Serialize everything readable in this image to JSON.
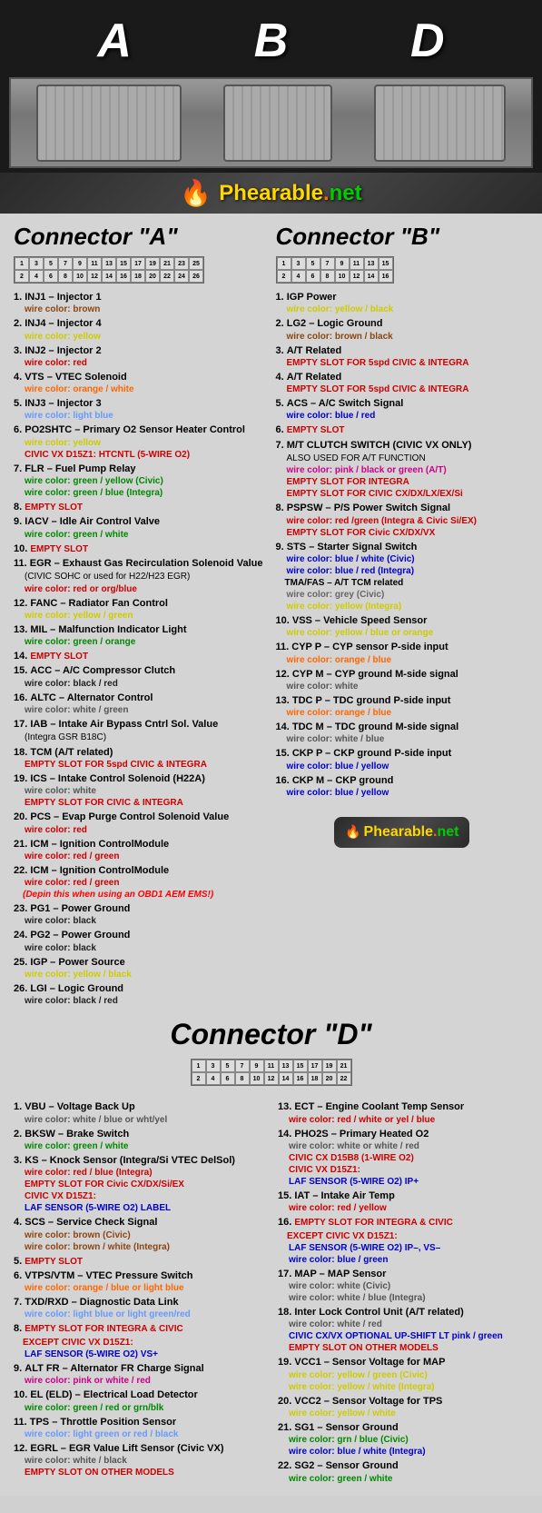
{
  "header": {
    "labels": [
      "A",
      "B",
      "D"
    ],
    "logo": "Phearable.net"
  },
  "connectorA": {
    "title": "Connector \"A\"",
    "pins_row1": [
      1,
      3,
      5,
      7,
      9,
      11,
      13,
      15,
      17,
      19,
      21,
      23,
      25
    ],
    "pins_row2": [
      2,
      4,
      6,
      8,
      10,
      12,
      14,
      16,
      18,
      20,
      22,
      24,
      26
    ],
    "items": [
      {
        "num": "1.",
        "label": "INJ1 – Injector 1",
        "color": "wire color: brown",
        "colorClass": "color-brown"
      },
      {
        "num": "2.",
        "label": "INJ4 – Injector 4",
        "color": "wire color: yellow",
        "colorClass": "color-yellow"
      },
      {
        "num": "3.",
        "label": "INJ2 – Injector 2",
        "color": "wire color: red",
        "colorClass": "color-red"
      },
      {
        "num": "4.",
        "label": "VTS – VTEC Solenoid",
        "color": "wire color: orange / white",
        "colorClass": "color-orange"
      },
      {
        "num": "5.",
        "label": "INJ3 – Injector 3",
        "color": "wire color: light blue",
        "colorClass": "color-lightblue"
      },
      {
        "num": "6.",
        "label": "PO2SHTC – Primary O2 Sensor Heater Control",
        "color": "wire color: yellow",
        "colorClass": "color-yellow",
        "note": "CIVIC VX D15Z1: HTCNTL (5-WIRE O2)",
        "noteClass": "civic-note"
      },
      {
        "num": "7.",
        "label": "FLR – Fuel Pump Relay",
        "color": "wire color: green / yellow (Civic)",
        "colorClass": "color-green",
        "color2": "wire color: green / blue (Integra)",
        "color2Class": "color-green"
      },
      {
        "num": "8.",
        "label": "EMPTY SLOT",
        "empty": true
      },
      {
        "num": "9.",
        "label": "IACV – Idle Air Control Valve",
        "color": "wire color: green / white",
        "colorClass": "color-green"
      },
      {
        "num": "10.",
        "label": "EMPTY SLOT",
        "empty": true
      },
      {
        "num": "11.",
        "label": "EGR – Exhaust Gas Recirculation Solenoid Value",
        "sublabel": "(CIVIC SOHC or used for H22/H23 EGR)",
        "color": "wire color: red or org/blue",
        "colorClass": "color-red"
      },
      {
        "num": "12.",
        "label": "FANC – Radiator Fan Control",
        "color": "wire color: yellow / green",
        "colorClass": "color-yellow"
      },
      {
        "num": "13.",
        "label": "MIL – Malfunction Indicator Light",
        "color": "wire color: green / orange",
        "colorClass": "color-green"
      },
      {
        "num": "14.",
        "label": "EMPTY SLOT",
        "empty": true
      },
      {
        "num": "15.",
        "label": "ACC – A/C Compressor Clutch",
        "color": "wire color: black / red",
        "colorClass": "color-black"
      },
      {
        "num": "16.",
        "label": "ALTC – Alternator Control",
        "color": "wire color: white / green",
        "colorClass": "color-white"
      },
      {
        "num": "17.",
        "label": "IAB – Intake Air Bypass Cntrl Sol. Value",
        "sublabel": "(Integra GSR B18C)",
        "color": "",
        "colorClass": ""
      },
      {
        "num": "18.",
        "label": "TCM (A/T related)",
        "empty": true,
        "emptyLabel": "EMPTY SLOT FOR 5spd CIVIC & INTEGRA"
      },
      {
        "num": "19.",
        "label": "ICS – Intake Control Solenoid (H22A)",
        "color": "wire color: white",
        "colorClass": "color-white",
        "note": "EMPTY SLOT FOR CIVIC & INTEGRA",
        "noteClass": "civic-note"
      },
      {
        "num": "20.",
        "label": "PCS – Evap Purge Control Solenoid Value",
        "color": "wire color: red",
        "colorClass": "color-red"
      },
      {
        "num": "21.",
        "label": "ICM – Ignition ControlModule",
        "color": "wire color: red / green",
        "colorClass": "color-red"
      },
      {
        "num": "22.",
        "label": "ICM – Ignition ControlModule",
        "color": "wire color: red / green",
        "colorClass": "color-red",
        "note": "(Depin this when using an OBD1 AEM EMS!)",
        "noteClass": "note-depin"
      },
      {
        "num": "23.",
        "label": "PG1 – Power Ground",
        "color": "wire color: black",
        "colorClass": "color-black"
      },
      {
        "num": "24.",
        "label": "PG2 – Power Ground",
        "color": "wire color: black",
        "colorClass": "color-black"
      },
      {
        "num": "25.",
        "label": "IGP  – Power Source",
        "color": "wire color: yellow / black",
        "colorClass": "color-yellow"
      },
      {
        "num": "26.",
        "label": "LGI – Logic Ground",
        "color": "wire color: black / red",
        "colorClass": "color-black"
      }
    ]
  },
  "connectorB": {
    "title": "Connector \"B\"",
    "pins_row1": [
      1,
      3,
      5,
      7,
      9,
      11,
      13,
      15
    ],
    "pins_row2": [
      2,
      4,
      6,
      8,
      10,
      12,
      14,
      16
    ],
    "items": [
      {
        "num": "1.",
        "label": "IGP  Power",
        "color": "wire color: yellow / black",
        "colorClass": "color-yellow"
      },
      {
        "num": "2.",
        "label": "LG2 – Logic Ground",
        "color": "wire color: brown / black",
        "colorClass": "color-brown"
      },
      {
        "num": "3.",
        "label": "A/T Related",
        "emptyLabel": "EMPTY SLOT FOR 5spd CIVIC & INTEGRA"
      },
      {
        "num": "4.",
        "label": "A/T Related",
        "emptyLabel": "EMPTY SLOT FOR 5spd CIVIC & INTEGRA"
      },
      {
        "num": "5.",
        "label": "ACS – A/C Switch Signal",
        "color": "wire color: blue / red",
        "colorClass": "color-blue"
      },
      {
        "num": "6.",
        "label": "EMPTY SLOT",
        "empty": true
      },
      {
        "num": "7.",
        "label": "M/T CLUTCH SWITCH (CIVIC VX ONLY)",
        "sublabel": "ALSO USED FOR A/T FUNCTION",
        "color": "wire color: pink / black or green (A/T)",
        "colorClass": "color-pink",
        "note": "EMPTY SLOT FOR INTEGRA",
        "noteClass": "civic-note",
        "note2": "EMPTY SLOT FOR CIVIC CX/DX/LX/EX/Si",
        "note2Class": "civic-note"
      },
      {
        "num": "8.",
        "label": "PSPSW – P/S Power Switch Signal",
        "color": "wire color: red /green (Integra & Civic Si/EX)",
        "colorClass": "color-red",
        "note": "EMPTY SLOT FOR Civic CX/DX/VX",
        "noteClass": "civic-note"
      },
      {
        "num": "9.",
        "label": "STS – Starter Signal Switch",
        "color": "wire color: blue / white (Civic)",
        "colorClass": "color-blue",
        "color2": "wire color: blue / red (Integra)",
        "color2Class": "color-blue",
        "sublabel2": "TMA/FAS – A/T TCM related",
        "color3": "wire color: grey (Civic)",
        "color3Class": "color-grey",
        "color4": "wire color: yellow (Integra)",
        "color4Class": "color-yellow"
      },
      {
        "num": "10.",
        "label": "VSS – Vehicle Speed Sensor",
        "color": "wire color: yellow / blue or orange",
        "colorClass": "color-yellow"
      },
      {
        "num": "11.",
        "label": "CYP P – CYP sensor P-side input",
        "color": "wire color: orange / blue",
        "colorClass": "color-orange"
      },
      {
        "num": "12.",
        "label": "CYP M – CYP ground M-side signal",
        "color": "wire color: white",
        "colorClass": "color-white"
      },
      {
        "num": "13.",
        "label": "TDC P – TDC ground P-side input",
        "color": "wire color: orange / blue",
        "colorClass": "color-orange"
      },
      {
        "num": "14.",
        "label": "TDC M – TDC ground M-side signal",
        "color": "wire color: white / blue",
        "colorClass": "color-white"
      },
      {
        "num": "15.",
        "label": "CKP P – CKP ground P-side input",
        "color": "wire color: blue / yellow",
        "colorClass": "color-blue"
      },
      {
        "num": "16.",
        "label": "CKP M – CKP ground",
        "color": "wire color: blue / yellow",
        "colorClass": "color-blue"
      }
    ]
  },
  "connectorD": {
    "title": "Connector \"D\"",
    "pins_row1": [
      1,
      3,
      5,
      7,
      9,
      11,
      13,
      15,
      17,
      19,
      21
    ],
    "pins_row2": [
      2,
      4,
      6,
      8,
      10,
      12,
      14,
      16,
      18,
      20,
      22
    ],
    "items_left": [
      {
        "num": "1.",
        "label": "VBU – Voltage Back Up",
        "color": "wire color: white / blue or wht/yel",
        "colorClass": "color-white"
      },
      {
        "num": "2.",
        "label": "BKSW – Brake Switch",
        "color": "wire color: green / white",
        "colorClass": "color-green"
      },
      {
        "num": "3.",
        "label": "KS – Knock Sensor (Integra/Si VTEC DelSol)",
        "color": "wire color: red / blue (Integra)",
        "colorClass": "color-red",
        "note": "EMPTY SLOT FOR Civic CX/DX/Si/EX",
        "noteClass": "civic-note",
        "note2": "CIVIC VX D15Z1:",
        "note2Class": "civic-note",
        "note3": "LAF SENSOR (5-WIRE O2) LABEL",
        "note3Class": "note-blue"
      },
      {
        "num": "4.",
        "label": "SCS – Service Check Signal",
        "color": "wire color: brown (Civic)",
        "colorClass": "color-brown",
        "color2": "wire color: brown / white (Integra)",
        "color2Class": "color-brown"
      },
      {
        "num": "5.",
        "label": "EMPTY SLOT",
        "empty": true
      },
      {
        "num": "6.",
        "label": "VTPS/VTM – VTEC Pressure Switch",
        "color": "wire color: orange / blue or light blue",
        "colorClass": "color-orange"
      },
      {
        "num": "7.",
        "label": "TXD/RXD – Diagnostic Data Link",
        "color": "wire color: light blue or light green/red",
        "colorClass": "color-lightblue"
      },
      {
        "num": "8.",
        "label": "EMPTY SLOT FOR INTEGRA & CIVIC",
        "emptyClass": "civic-note",
        "sublabel": "EXCEPT CIVIC VX D15Z1:",
        "sublabelClass": "civic-note",
        "note": "LAF SENSOR (5-WIRE O2) VS+",
        "noteClass": "note-blue"
      },
      {
        "num": "9.",
        "label": "ALT FR – Alternator FR Charge Signal",
        "color": "wire color: pink or white / red",
        "colorClass": "color-pink"
      },
      {
        "num": "10.",
        "label": "EL (ELD) – Electrical Load Detector",
        "color": "wire color: green / red or grn/blk",
        "colorClass": "color-green"
      },
      {
        "num": "11.",
        "label": "TPS – Throttle Position Sensor",
        "color": "wire color: light green or red / black",
        "colorClass": "color-lightblue"
      },
      {
        "num": "12.",
        "label": "EGRL – EGR Value Lift Sensor (Civic VX)",
        "color": "wire color: white / black",
        "colorClass": "color-white",
        "note": "EMPTY SLOT ON OTHER MODELS",
        "noteClass": "civic-note"
      }
    ],
    "items_right": [
      {
        "num": "13.",
        "label": "ECT – Engine Coolant Temp Sensor",
        "color": "wire color: red / white or yel / blue",
        "colorClass": "color-red"
      },
      {
        "num": "14.",
        "label": "PHO2S – Primary Heated O2",
        "color": "wire color: white or white / red",
        "colorClass": "color-white",
        "note": "CIVIC CX D15B8 (1-WIRE O2)",
        "noteClass": "civic-note",
        "note2": "CIVIC VX D15Z1:",
        "note2Class": "civic-note",
        "note3": "LAF SENSOR (5-WIRE O2) IP+",
        "note3Class": "note-blue"
      },
      {
        "num": "15.",
        "label": "IAT – Intake Air Temp",
        "color": "wire color: red / yellow",
        "colorClass": "color-red"
      },
      {
        "num": "16.",
        "label": "EMPTY SLOT FOR INTEGRA & CIVIC",
        "emptyClass": "civic-note",
        "sublabel": "EXCEPT CIVIC VX D15Z1:",
        "sublabelClass": "civic-note",
        "note": "LAF SENSOR (5-WIRE O2) IP–, VS–",
        "noteClass": "note-blue",
        "color": "wire color: blue / green",
        "colorClass": "color-blue"
      },
      {
        "num": "17.",
        "label": "MAP – MAP Sensor",
        "color": "wire color: white (Civic)",
        "colorClass": "color-white",
        "color2": "wire color: white / blue (Integra)",
        "color2Class": "color-white"
      },
      {
        "num": "18.",
        "label": "Inter Lock Control Unit (A/T related)",
        "color": "wire color: white / red",
        "colorClass": "color-white",
        "note": "CIVIC CX/VX OPTIONAL UP-SHIFT LT  pink / green",
        "noteClass": "note-blue",
        "note2": "EMPTY SLOT ON OTHER MODELS",
        "note2Class": "civic-note"
      },
      {
        "num": "19.",
        "label": "VCC1 – Sensor Voltage for MAP",
        "color": "wire color: yellow / green (Civic)",
        "colorClass": "color-yellow",
        "color2": "wire color: yellow / white (Integra)",
        "color2Class": "color-yellow"
      },
      {
        "num": "20.",
        "label": "VCC2 – Sensor Voltage for TPS",
        "color": "wire color: yellow / white",
        "colorClass": "color-yellow"
      },
      {
        "num": "21.",
        "label": "SG1 – Sensor Ground",
        "color": "wire color: grn / blue (Civic)",
        "colorClass": "color-green",
        "color2": "wire color: blue / white (Integra)",
        "color2Class": "color-blue"
      },
      {
        "num": "22.",
        "label": "SG2 – Sensor Ground",
        "color": "wire color: green / white",
        "colorClass": "color-green"
      }
    ]
  }
}
